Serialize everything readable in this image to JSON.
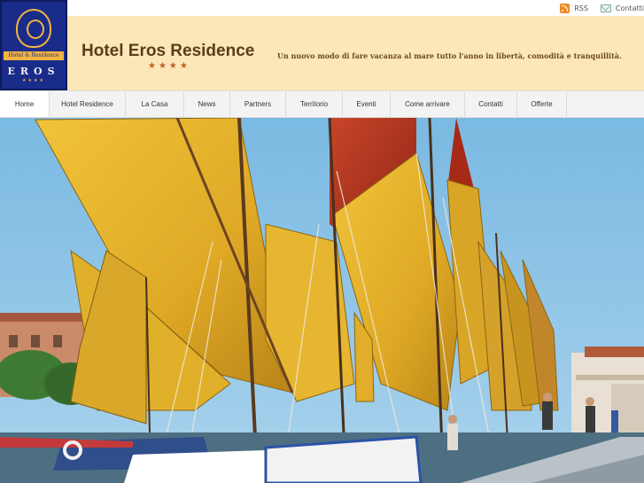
{
  "topbar": {
    "links": [
      {
        "label": "RSS",
        "icon": "rss-icon"
      },
      {
        "label": "Contatti",
        "icon": "mail-icon"
      }
    ]
  },
  "logo": {
    "ribbon_text": "Hotel & Residence",
    "word": "EROS",
    "stars": "★★★★"
  },
  "header": {
    "title": "Hotel Eros Residence",
    "stars": "★★★★",
    "tagline": "Un nuovo modo di fare vacanza al mare tutto l'anno in libertà, comodità e tranquillità.",
    "background": "#fbe7b8"
  },
  "nav": {
    "items": [
      {
        "label": "Home",
        "active": true
      },
      {
        "label": "Hotel Residence"
      },
      {
        "label": "La Casa"
      },
      {
        "label": "News"
      },
      {
        "label": "Partners"
      },
      {
        "label": "Territorio"
      },
      {
        "label": "Eventi"
      },
      {
        "label": "Come arrivare"
      },
      {
        "label": "Contatti"
      },
      {
        "label": "Offerte"
      }
    ]
  },
  "hero": {
    "subject": "harbor with traditional yellow and red sailboats",
    "colors": {
      "sky": "#8ec6e6",
      "sail_yellow": "#e8b52a",
      "sail_red": "#b8351f"
    }
  }
}
